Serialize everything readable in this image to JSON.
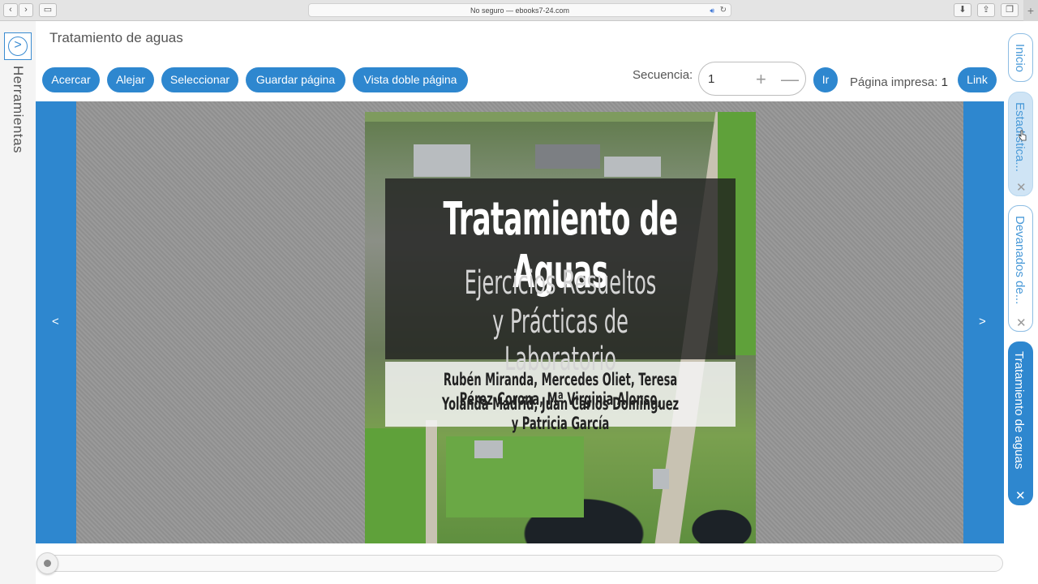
{
  "browser": {
    "url_text": "No seguro — ebooks7-24.com",
    "back_icon": "chevron-left-icon",
    "forward_icon": "chevron-right-icon",
    "plus_label": "+"
  },
  "tools": {
    "label": "Herramientas",
    "toggle_glyph": ">"
  },
  "header": {
    "title": "Tratamiento de aguas"
  },
  "toolbar": {
    "zoom_in": "Acercar",
    "zoom_out": "Alejar",
    "select": "Seleccionar",
    "save_page": "Guardar página",
    "double_page": "Vista doble página",
    "sequence_label": "Secuencia:",
    "sequence_value": "1",
    "plus": "+",
    "minus": "—",
    "go": "Ir",
    "printed_page_label": "Página impresa:",
    "printed_page_value": "1",
    "link": "Link"
  },
  "viewer": {
    "prev": "<",
    "next": ">",
    "cover": {
      "title": "Tratamiento de Aguas",
      "subtitle_1": "Ejercicios Resueltos",
      "subtitle_2": "y Prácticas de Laboratorio",
      "authors_1": "Rubén Miranda, Mercedes Oliet, Teresa Pérez-Corona, Mª Virginia Alonso,",
      "authors_2": "Yolanda Madrid, Juan Carlos Domínguez y Patricia García"
    }
  },
  "slider": {
    "position_fraction": 0
  },
  "right_tabs": [
    {
      "label": "Inicio"
    },
    {
      "label": "Estadística...",
      "close": "✕"
    },
    {
      "label": "Devanados de...",
      "close": "✕"
    },
    {
      "label": "Tratamiento de aguas",
      "close": "✕"
    }
  ],
  "colors": {
    "accent": "#2e87cf",
    "tab_light": "#cfe4f5"
  }
}
